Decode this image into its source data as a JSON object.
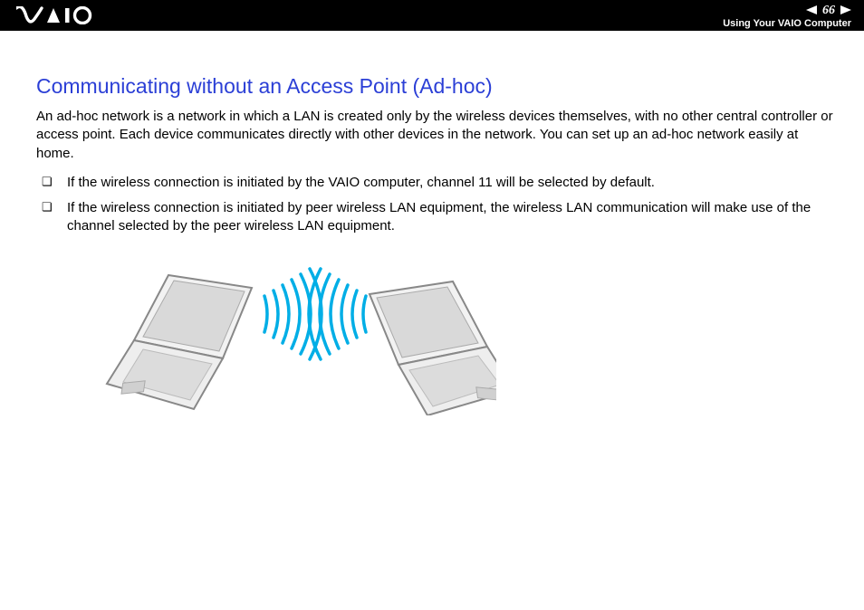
{
  "header": {
    "page_number": "66",
    "section": "Using Your VAIO Computer"
  },
  "content": {
    "title": "Communicating without an Access Point (Ad-hoc)",
    "intro": "An ad-hoc network is a network in which a LAN is created only by the wireless devices themselves, with no other central controller or access point. Each device communicates directly with other devices in the network. You can set up an ad-hoc network easily at home.",
    "bullets": [
      "If the wireless connection is initiated by the VAIO computer, channel 11 will be selected by default.",
      "If the wireless connection is initiated by peer wireless LAN equipment, the wireless LAN communication will make use of the channel selected by the peer wireless LAN equipment."
    ]
  }
}
